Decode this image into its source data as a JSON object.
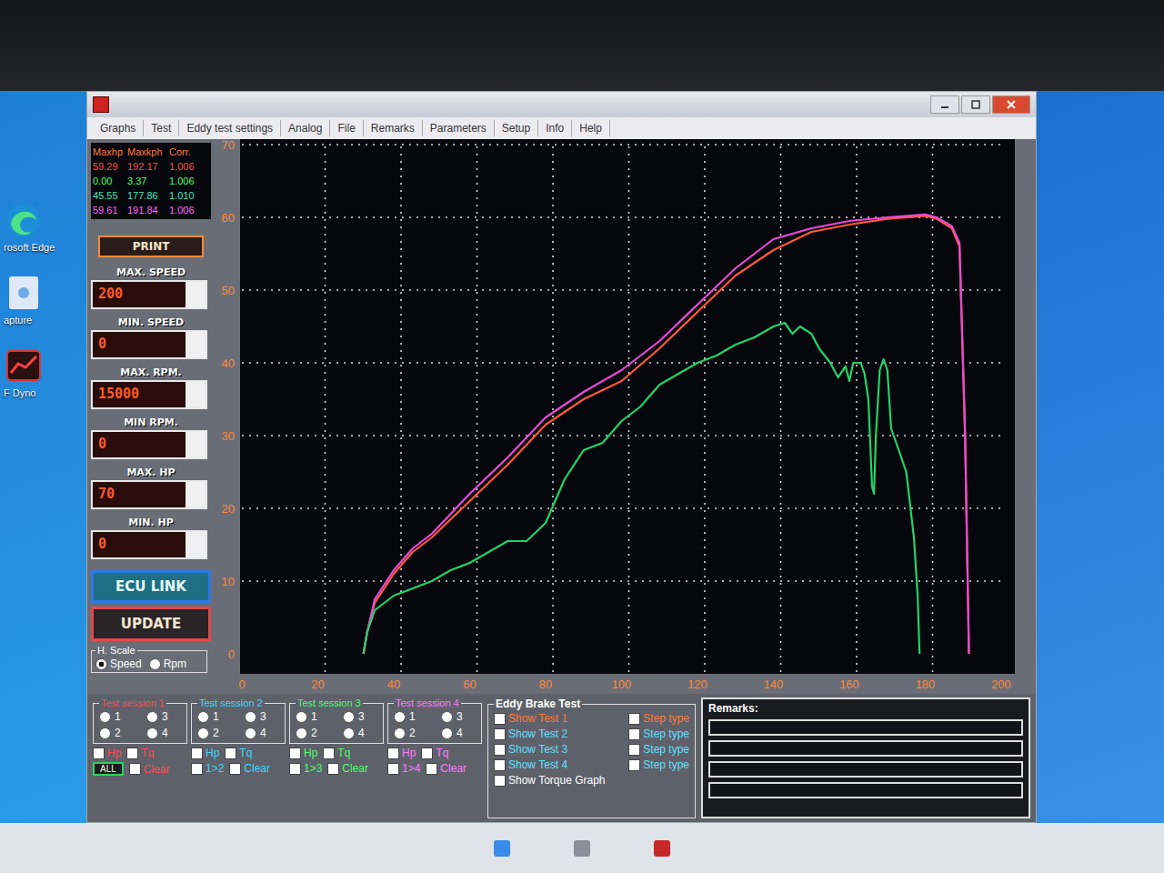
{
  "desktop": {
    "icons": [
      {
        "label": "rosoft Edge",
        "kind": "edge"
      },
      {
        "label": "apture",
        "kind": "file"
      },
      {
        "label": "F Dyno",
        "kind": "dyno"
      }
    ]
  },
  "menu": [
    "Graphs",
    "Test",
    "Eddy test settings",
    "Analog",
    "File",
    "Remarks",
    "Parameters",
    "Setup",
    "Info",
    "Help"
  ],
  "legend": {
    "headers": [
      "Maxhp",
      "Maxkph",
      "Corr."
    ],
    "rows": [
      {
        "values": [
          "59.29",
          "192.17",
          "1.006"
        ],
        "color": "#ff4a4a"
      },
      {
        "values": [
          "0.00",
          "3.37",
          "1.006"
        ],
        "color": "#4cff6a"
      },
      {
        "values": [
          "45.55",
          "177.86",
          "1.010"
        ],
        "color": "#3fe6c0"
      },
      {
        "values": [
          "59.61",
          "191.84",
          "1.006"
        ],
        "color": "#ff66ff"
      }
    ]
  },
  "print_button": "PRINT",
  "fields": [
    {
      "label": "MAX. SPEED",
      "value": "200"
    },
    {
      "label": "MIN. SPEED",
      "value": "0"
    },
    {
      "label": "MAX. RPM.",
      "value": "15000"
    },
    {
      "label": "MIN RPM.",
      "value": "0"
    },
    {
      "label": "MAX. HP",
      "value": "70"
    },
    {
      "label": "MIN. HP",
      "value": "0"
    }
  ],
  "ecu_button": "ECU LINK",
  "update_button": "UPDATE",
  "h_scale": {
    "label": "H. Scale",
    "options": [
      {
        "label": "Speed",
        "selected": true
      },
      {
        "label": "Rpm",
        "selected": false
      }
    ]
  },
  "chart": {
    "y_ticks": [
      "0",
      "10",
      "20",
      "30",
      "40",
      "50",
      "60",
      "70"
    ],
    "x_ticks": [
      "0",
      "20",
      "40",
      "60",
      "80",
      "100",
      "120",
      "140",
      "160",
      "180",
      "200"
    ],
    "series": [
      {
        "color": "#ff5a36",
        "x": [
          32,
          33,
          35,
          40,
          45,
          50,
          60,
          70,
          80,
          90,
          100,
          110,
          120,
          130,
          140,
          150,
          160,
          170,
          180,
          183,
          187,
          189,
          190.5,
          191.5
        ],
        "values": [
          0,
          3,
          7,
          11,
          14,
          16,
          21,
          26,
          31.5,
          35,
          37.5,
          42,
          47,
          52,
          55.5,
          58,
          59,
          59.8,
          60.2,
          59.8,
          58.5,
          56,
          30,
          0
        ]
      },
      {
        "color": "#e84ad8",
        "x": [
          32,
          33,
          35,
          40,
          45,
          50,
          60,
          70,
          80,
          90,
          100,
          110,
          120,
          130,
          140,
          150,
          160,
          170,
          180,
          183,
          187,
          189,
          190.5,
          191.5
        ],
        "values": [
          0,
          3,
          7.5,
          11.5,
          14.5,
          16.5,
          22,
          27,
          32.5,
          36,
          39,
          43,
          48,
          53,
          57,
          58.5,
          59.5,
          60,
          60.4,
          60,
          58.8,
          56.5,
          30,
          0
        ]
      },
      {
        "color": "#22d36a",
        "x": [
          32,
          33,
          35,
          40,
          45,
          50,
          55,
          60,
          65,
          70,
          75,
          80,
          85,
          90,
          95,
          100,
          105,
          110,
          115,
          120,
          125,
          130,
          135,
          140,
          143,
          145,
          147,
          150,
          152,
          155,
          157,
          159,
          160,
          161,
          163,
          164,
          165,
          166,
          166.5,
          167,
          168,
          169,
          170,
          171,
          173,
          175,
          177,
          178,
          178.5
        ],
        "values": [
          0,
          3,
          6,
          8,
          9,
          10,
          11.5,
          12.5,
          14,
          15.5,
          15.5,
          18,
          24,
          28,
          29,
          32,
          34,
          37,
          38.5,
          40,
          41,
          42.5,
          43.5,
          45,
          45.5,
          44,
          45,
          44,
          42,
          40,
          38,
          39.5,
          37.5,
          40,
          40,
          38.5,
          35,
          23,
          22,
          30,
          39,
          40.5,
          39,
          31,
          28,
          25,
          16,
          8,
          0
        ]
      }
    ]
  },
  "sessions": [
    {
      "title": "Test session 1",
      "color": "#ff4a4a",
      "radios": [
        {
          "label": "1",
          "selected": false
        },
        {
          "label": "2",
          "selected": false
        },
        {
          "label": "3",
          "selected": false
        },
        {
          "label": "4",
          "selected": false
        }
      ],
      "checks": [
        {
          "label": "Hp",
          "checked": false
        },
        {
          "label": "Tq",
          "checked": false
        }
      ],
      "extra": [
        {
          "label": "ALL",
          "kind": "button"
        },
        {
          "label": "Clear",
          "kind": "check"
        }
      ]
    },
    {
      "title": "Test session 2",
      "color": "#3fd6ff",
      "radios": [
        {
          "label": "1",
          "selected": false
        },
        {
          "label": "2",
          "selected": false
        },
        {
          "label": "3",
          "selected": false
        },
        {
          "label": "4",
          "selected": false
        }
      ],
      "checks": [
        {
          "label": "Hp",
          "checked": false
        },
        {
          "label": "Tq",
          "checked": false
        }
      ],
      "extra": [
        {
          "label": "1>2",
          "kind": "check"
        },
        {
          "label": "Clear",
          "kind": "check"
        }
      ]
    },
    {
      "title": "Test session 3",
      "color": "#4cff6a",
      "radios": [
        {
          "label": "1",
          "selected": false
        },
        {
          "label": "2",
          "selected": false
        },
        {
          "label": "3",
          "selected": false
        },
        {
          "label": "4",
          "selected": false
        }
      ],
      "checks": [
        {
          "label": "Hp",
          "checked": false
        },
        {
          "label": "Tq",
          "checked": false
        }
      ],
      "extra": [
        {
          "label": "1>3",
          "kind": "check"
        },
        {
          "label": "Clear",
          "kind": "check"
        }
      ]
    },
    {
      "title": "Test session 4",
      "color": "#ff7aff",
      "radios": [
        {
          "label": "1",
          "selected": false
        },
        {
          "label": "2",
          "selected": false
        },
        {
          "label": "3",
          "selected": false
        },
        {
          "label": "4",
          "selected": false
        }
      ],
      "checks": [
        {
          "label": "Hp",
          "checked": false
        },
        {
          "label": "Tq",
          "checked": false
        }
      ],
      "extra": [
        {
          "label": "1>4",
          "kind": "check"
        },
        {
          "label": "Clear",
          "kind": "check"
        }
      ]
    }
  ],
  "eddy": {
    "title": "Eddy Brake Test",
    "rows": [
      {
        "show": "Show Test 1",
        "step": "Step type",
        "color": "#ff7a3a"
      },
      {
        "show": "Show Test 2",
        "step": "Step type",
        "color": "#5fe0ff"
      },
      {
        "show": "Show Test 3",
        "step": "Step type",
        "color": "#5fe0ff"
      },
      {
        "show": "Show Test 4",
        "step": "Step type",
        "color": "#5fe0ff"
      }
    ],
    "torque": "Show Torque Graph"
  },
  "remarks": {
    "title": "Remarks:",
    "lines": 4
  }
}
